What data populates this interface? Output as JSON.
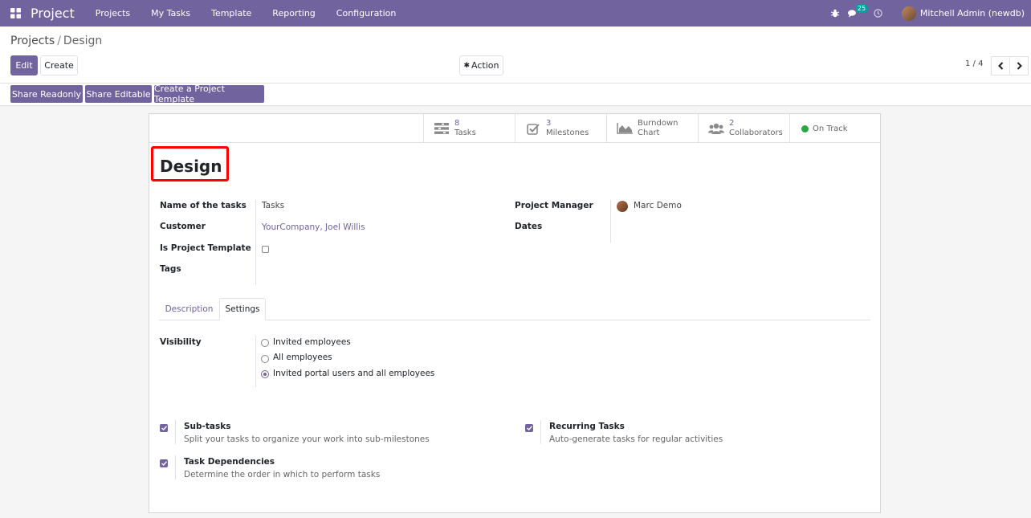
{
  "navbar": {
    "brand": "Project",
    "menu": [
      "Projects",
      "My Tasks",
      "Template",
      "Reporting",
      "Configuration"
    ],
    "messages_count": "25",
    "user": "Mitchell Admin (newdb)",
    "icons": [
      "apps-icon",
      "bug-icon",
      "chat-icon",
      "clock-icon"
    ]
  },
  "breadcrumb": {
    "parent": "Projects",
    "separator": "/",
    "current": "Design"
  },
  "toolbar": {
    "edit": "Edit",
    "create": "Create",
    "action": "Action",
    "pager": "1 / 4"
  },
  "statusbar": {
    "share_readonly": "Share Readonly",
    "share_editable": "Share Editable",
    "create_template": "Create a Project Template"
  },
  "smart_buttons": [
    {
      "count": "8",
      "label": "Tasks",
      "icon": "tasks-icon"
    },
    {
      "count": "3",
      "label": "Milestones",
      "icon": "check-square-icon"
    },
    {
      "line1": "Burndown",
      "line2": "Chart",
      "icon": "area-chart-icon"
    },
    {
      "count": "2",
      "label": "Collaborators",
      "icon": "users-icon"
    },
    {
      "label": "On Track",
      "status_color": "#28a745"
    }
  ],
  "record": {
    "title": "Design",
    "fields": {
      "name_of_tasks_label": "Name of the tasks",
      "name_of_tasks_value": "Tasks",
      "customer_label": "Customer",
      "customer_value": "YourCompany, Joel Willis",
      "is_template_label": "Is Project Template",
      "tags_label": "Tags",
      "manager_label": "Project Manager",
      "manager_value": "Marc Demo",
      "dates_label": "Dates"
    }
  },
  "tabs": {
    "description": "Description",
    "settings": "Settings"
  },
  "visibility": {
    "label": "Visibility",
    "options": [
      "Invited employees",
      "All employees",
      "Invited portal users and all employees"
    ],
    "selected": "Invited portal users and all employees"
  },
  "settings": {
    "subtasks_title": "Sub-tasks",
    "subtasks_desc": "Split your tasks to organize your work into sub-milestones",
    "recurring_title": "Recurring Tasks",
    "recurring_desc": "Auto-generate tasks for regular activities",
    "dependencies_title": "Task Dependencies",
    "dependencies_desc": "Determine the order in which to perform tasks"
  },
  "colors": {
    "brand": "#71639e",
    "highlight": "#ff0000",
    "status_green": "#28a745"
  }
}
